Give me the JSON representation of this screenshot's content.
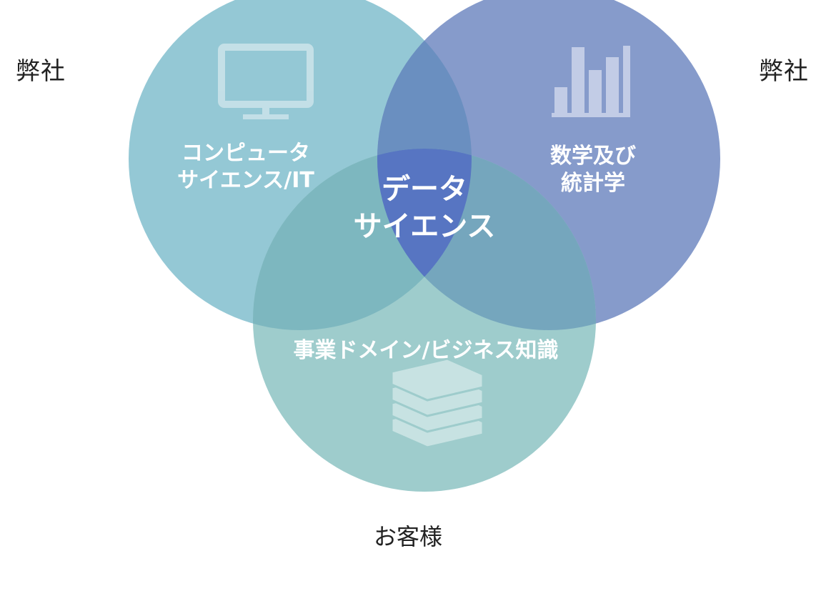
{
  "labels": {
    "left": "弊社",
    "right": "弊社",
    "bottom": "お客様"
  },
  "circles": {
    "cs": {
      "line1": "コンピュータ",
      "line2": "サイエンス/IT",
      "icon": "monitor-icon",
      "color": "#86bfcf"
    },
    "math": {
      "line1": "数学及び",
      "line2": "統計学",
      "icon": "bar-chart-icon",
      "color": "#7b93c6"
    },
    "business": {
      "line1": "事業ドメイン/ビジネス知識",
      "icon": "books-icon",
      "color": "#8ec2c4"
    }
  },
  "center": {
    "line1": "データ",
    "line2": "サイエンス",
    "color": "#4e6cc0"
  }
}
